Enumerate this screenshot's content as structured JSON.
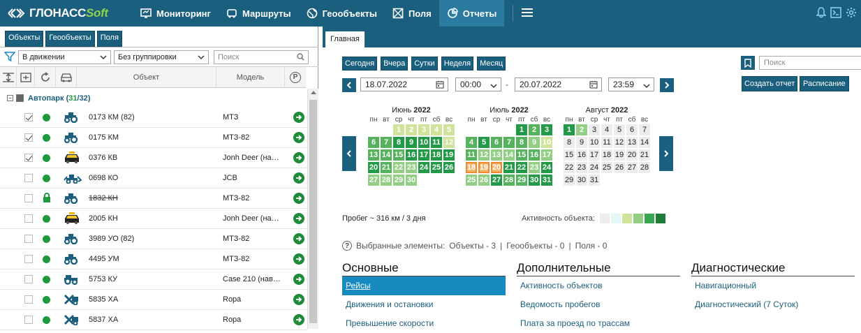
{
  "app": {
    "logo_main": "ГЛОНАСС",
    "logo_soft": "Soft",
    "nav": [
      {
        "label": "Мониторинг",
        "icon": "monitor-icon"
      },
      {
        "label": "Маршруты",
        "icon": "route-icon"
      },
      {
        "label": "Геообъекты",
        "icon": "globe-icon"
      },
      {
        "label": "Поля",
        "icon": "field-icon"
      },
      {
        "label": "Отчеты",
        "icon": "reports-icon",
        "active": true
      }
    ],
    "right_icons": [
      "bell-icon",
      "terminal-icon",
      "gear-icon"
    ]
  },
  "left": {
    "tabs": [
      "Объекты",
      "Геообъекты",
      "Поля"
    ],
    "filter_value": "В движении",
    "grouping_value": "Без группировки",
    "search_placeholder": "Поиск",
    "columns": {
      "object": "Объект",
      "model": "Модель",
      "p_icon": "P"
    },
    "group": {
      "name": "Автопарк",
      "count_selected": "31",
      "count_total": "32"
    },
    "rows": [
      {
        "checked": true,
        "status": "dot",
        "vehicle": "tractor",
        "object": "0173 КМ (82)",
        "model": "МТЗ",
        "strike": false
      },
      {
        "checked": true,
        "status": "dot",
        "vehicle": "tractor",
        "object": "0175 КМ",
        "model": "МТЗ-82",
        "strike": false
      },
      {
        "checked": true,
        "status": "dot",
        "vehicle": "taxi",
        "object": "0376 КВ",
        "model": "Jonh Deer (на…",
        "strike": false
      },
      {
        "checked": false,
        "status": "dot",
        "vehicle": "excavator",
        "object": "0698 КО",
        "model": "JCB",
        "strike": false
      },
      {
        "checked": false,
        "status": "lock",
        "vehicle": "tractor",
        "object": "1832 КН",
        "model": "МТЗ-82",
        "strike": true
      },
      {
        "checked": false,
        "status": "dot",
        "vehicle": "taxi",
        "object": "2005 КН",
        "model": "Jonh Deer (на…",
        "strike": false
      },
      {
        "checked": false,
        "status": "dot",
        "vehicle": "tractor",
        "object": "3989 УО (82)",
        "model": "МТЗ-82",
        "strike": false
      },
      {
        "checked": false,
        "status": "dot",
        "vehicle": "tractor",
        "object": "4495 УМ",
        "model": "МТЗ-82",
        "strike": false
      },
      {
        "checked": false,
        "status": "dot",
        "vehicle": "tractor2",
        "object": "5753 КУ",
        "model": "Case 210 (нав…",
        "strike": false
      },
      {
        "checked": false,
        "status": "dot",
        "vehicle": "harvester",
        "object": "5835 ХА",
        "model": "Ropa",
        "strike": false
      },
      {
        "checked": false,
        "status": "dot",
        "vehicle": "harvester",
        "object": "5837 ХА",
        "model": "Ropa",
        "strike": false
      }
    ]
  },
  "right": {
    "tab": "Главная",
    "periods": [
      "Сегодня",
      "Вчера",
      "Сутки",
      "Неделя",
      "Месяц"
    ],
    "date_from": "18.07.2022",
    "time_from": "00:00",
    "dash": "-",
    "date_to": "20.07.2022",
    "time_to": "23:59",
    "search_placeholder": "Поиск",
    "create_report": "Создать отчет",
    "schedule": "Расписание",
    "weekdays": [
      "пн",
      "вт",
      "ср",
      "чт",
      "пт",
      "сб",
      "вс"
    ],
    "months": [
      {
        "name": "Июнь",
        "year": "2022",
        "offset": 2,
        "days": 30,
        "levels": [
          1,
          1,
          1,
          1,
          1,
          3,
          3,
          4,
          4,
          4,
          4,
          1,
          3,
          3,
          3,
          4,
          4,
          4,
          4,
          4,
          3,
          2,
          2,
          4,
          4,
          4,
          2,
          2,
          2,
          2
        ]
      },
      {
        "name": "Июль",
        "year": "2022",
        "offset": 4,
        "days": 31,
        "levels": [
          4,
          3,
          4,
          3,
          4,
          3,
          3,
          3,
          2,
          1,
          3,
          2,
          2,
          2,
          3,
          3,
          2,
          5,
          5,
          5,
          4,
          4,
          2,
          4,
          2,
          2,
          4,
          3,
          3,
          4,
          4
        ]
      },
      {
        "name": "Август",
        "year": "2022",
        "offset": 0,
        "days": 31,
        "levels": [
          4,
          2,
          0,
          0,
          0,
          0,
          0,
          0,
          0,
          0,
          0,
          0,
          0,
          0,
          0,
          0,
          0,
          0,
          0,
          0,
          0,
          0,
          0,
          0,
          0,
          0,
          0,
          0,
          0,
          0,
          0
        ]
      }
    ],
    "mileage": "Пробег ~ 316 км / 3 дня",
    "activity_label": "Активность объекта:",
    "legend_colors": [
      "#ececec",
      "#e5f7f7",
      "#cfe49a",
      "#92cf84",
      "#3aa652",
      "#1f7b35"
    ],
    "selected_label": "Выбранные элементы:",
    "selected_objects": "Объекты - 3",
    "selected_geo": "Геообъекты - 0",
    "selected_fields": "Поля - 0",
    "sep": "|",
    "sections": [
      {
        "title": "Основные",
        "items": [
          "Рейсы",
          "Движения и остановки",
          "Превышение скорости"
        ],
        "active": 0
      },
      {
        "title": "Дополнительные",
        "items": [
          "Активность объектов",
          "Ведомость пробегов",
          "Плата за проезд по трассам"
        ],
        "active": -1
      },
      {
        "title": "Диагностические",
        "items": [
          "Навигационный",
          "Диагностический (7 Суток)"
        ],
        "active": -1
      }
    ]
  }
}
